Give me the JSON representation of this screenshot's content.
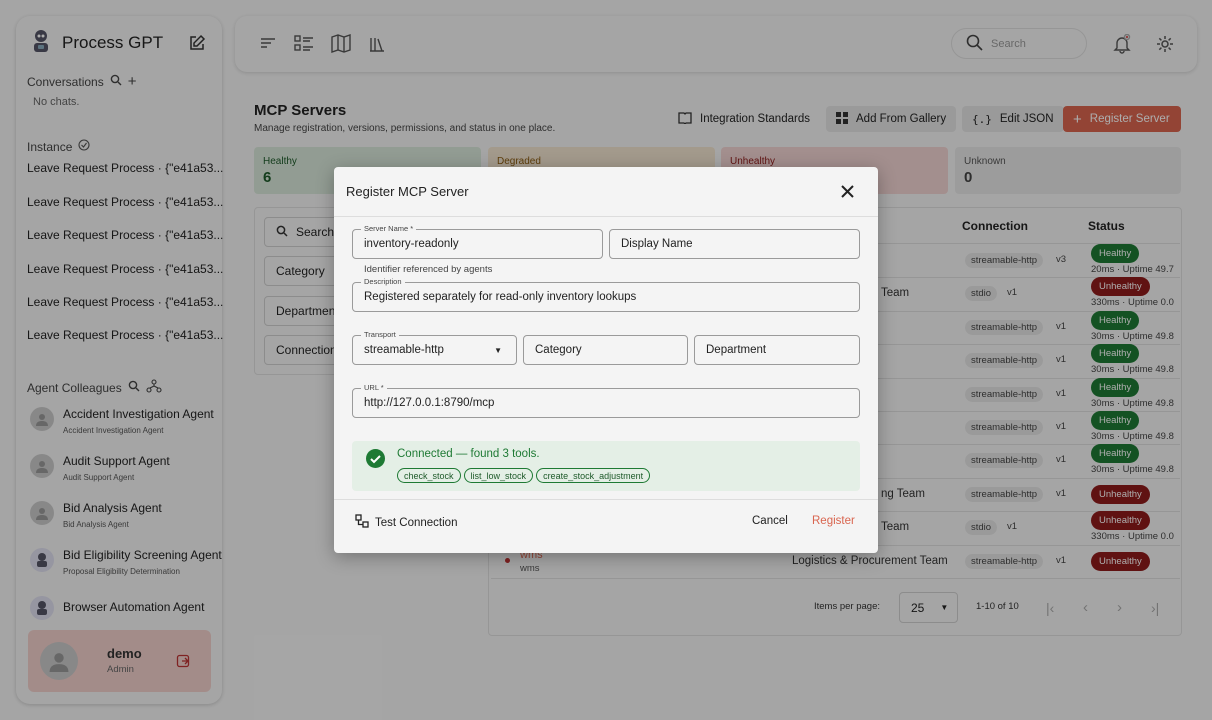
{
  "app": {
    "title": "Process GPT"
  },
  "sidebar": {
    "conversations_label": "Conversations",
    "no_chats": "No chats.",
    "instance_label": "Instance",
    "instances": [
      "Leave Request Process · {\"e41a53...",
      "Leave Request Process · {\"e41a53...",
      "Leave Request Process · {\"e41a53...",
      "Leave Request Process · {\"e41a53...",
      "Leave Request Process · {\"e41a53...",
      "Leave Request Process · {\"e41a53..."
    ],
    "agent_colleagues_label": "Agent Colleagues",
    "agents": [
      {
        "name": "Accident Investigation Agent",
        "sub": "Accident Investigation Agent",
        "icon": "avatar-placeholder"
      },
      {
        "name": "Audit Support Agent",
        "sub": "Audit Support Agent",
        "icon": "avatar-placeholder"
      },
      {
        "name": "Bid Analysis Agent",
        "sub": "Bid Analysis Agent",
        "icon": "avatar-placeholder"
      },
      {
        "name": "Bid Eligibility Screening Agent",
        "sub": "Proposal Eligibility Determination",
        "icon": "robot-icon"
      },
      {
        "name": "Browser Automation Agent",
        "sub": "",
        "icon": "robot-icon"
      }
    ],
    "user": {
      "name": "demo",
      "role": "Admin"
    }
  },
  "topbar": {
    "search_placeholder": "Search"
  },
  "page": {
    "title": "MCP Servers",
    "subtitle": "Manage registration, versions, permissions, and status in one place.",
    "buttons": {
      "integration": "Integration Standards",
      "gallery": "Add From Gallery",
      "edit_json": "Edit JSON",
      "register": "Register Server"
    },
    "stats": [
      {
        "label": "Healthy",
        "value": "6"
      },
      {
        "label": "Degraded",
        "value": ""
      },
      {
        "label": "Unhealthy",
        "value": ""
      },
      {
        "label": "Unknown",
        "value": "0"
      }
    ],
    "filters": {
      "search": "Search",
      "category": "Category",
      "department": "Department",
      "connection": "Connection"
    },
    "table": {
      "col_connection": "Connection",
      "col_status": "Status",
      "rows": [
        {
          "team": "",
          "conn": "streamable-http",
          "ver": "v3",
          "status": "Healthy",
          "uptime": "20ms · Uptime 49.7"
        },
        {
          "team": "Team",
          "conn": "stdio",
          "ver": "v1",
          "status": "Unhealthy",
          "uptime": "330ms · Uptime 0.0"
        },
        {
          "team": "",
          "conn": "streamable-http",
          "ver": "v1",
          "status": "Healthy",
          "uptime": "30ms · Uptime 49.8"
        },
        {
          "team": "",
          "conn": "streamable-http",
          "ver": "v1",
          "status": "Healthy",
          "uptime": "30ms · Uptime 49.8"
        },
        {
          "team": "",
          "conn": "streamable-http",
          "ver": "v1",
          "status": "Healthy",
          "uptime": "30ms · Uptime 49.8"
        },
        {
          "team": "",
          "conn": "streamable-http",
          "ver": "v1",
          "status": "Healthy",
          "uptime": "30ms · Uptime 49.8"
        },
        {
          "team": "",
          "conn": "streamable-http",
          "ver": "v1",
          "status": "Healthy",
          "uptime": "30ms · Uptime 49.8"
        },
        {
          "team": "ng Team",
          "conn": "streamable-http",
          "ver": "v1",
          "status": "Unhealthy",
          "uptime": ""
        },
        {
          "team": "Team",
          "conn": "stdio",
          "ver": "v1",
          "status": "Unhealthy",
          "uptime": "330ms · Uptime 0.0"
        },
        {
          "team": "Logistics & Procurement Team",
          "conn": "streamable-http",
          "ver": "v1",
          "status": "Unhealthy",
          "uptime": ""
        }
      ],
      "last_row_name": "wms",
      "last_row_sub": "wms"
    },
    "pagination": {
      "items_per_page_label": "Items per page:",
      "items_per_page": "25",
      "range": "1-10 of 10"
    }
  },
  "modal": {
    "title": "Register MCP Server",
    "server_name_label": "Server Name *",
    "server_name_value": "inventory-readonly",
    "server_name_hint": "Identifier referenced by agents",
    "display_name_placeholder": "Display Name",
    "description_label": "Description",
    "description_value": "Registered separately for read-only inventory lookups",
    "transport_label": "Transport",
    "transport_value": "streamable-http",
    "category_placeholder": "Category",
    "department_placeholder": "Department",
    "url_label": "URL *",
    "url_value": "http://127.0.0.1:8790/mcp",
    "connected_text": "Connected — found 3 tools.",
    "tools": [
      "check_stock",
      "list_low_stock",
      "create_stock_adjustment"
    ],
    "test_connection": "Test Connection",
    "cancel": "Cancel",
    "register": "Register"
  },
  "colors": {
    "healthy": "#1e7a34",
    "unhealthy": "#8e1b1b",
    "accent": "#d9654f",
    "success_bg": "#e4efe6"
  }
}
